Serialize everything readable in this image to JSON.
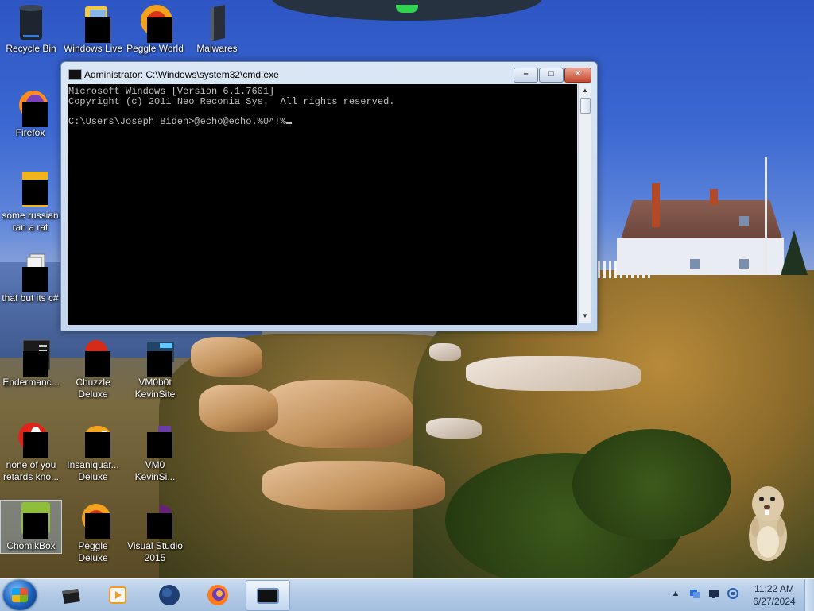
{
  "desktop": {
    "icons": [
      {
        "label": "Recycle Bin",
        "icon": "recycle-bin-icon"
      },
      {
        "label": "Windows Live",
        "icon": "windows-live-icon"
      },
      {
        "label": "Peggle World",
        "icon": "peggle-icon"
      },
      {
        "label": "Malwares",
        "icon": "folder-icon"
      },
      {
        "label": "Firefox",
        "icon": "firefox-icon"
      },
      {
        "label": "some russian ran a rat",
        "icon": "script-icon"
      },
      {
        "label": "that but its c#",
        "icon": "copies-icon"
      },
      {
        "label": "Endermanc...",
        "icon": "app-icon"
      },
      {
        "label": "Chuzzle Deluxe",
        "icon": "chuzzle-icon"
      },
      {
        "label": "VM0b0t KevinSite",
        "icon": "vm-icon"
      },
      {
        "label": "none of you retards kno...",
        "icon": "opera-icon"
      },
      {
        "label": "Insaniquar... Deluxe",
        "icon": "insaniquarium-icon"
      },
      {
        "label": "VM0 KevinSi...",
        "icon": "vm-icon"
      },
      {
        "label": "ChomikBox",
        "icon": "chomikbox-icon"
      },
      {
        "label": "Peggle Deluxe",
        "icon": "peggle-icon"
      },
      {
        "label": "Visual Studio 2015",
        "icon": "visual-studio-icon"
      }
    ]
  },
  "cmd_window": {
    "title": "Administrator: C:\\Windows\\system32\\cmd.exe",
    "buttons": {
      "minimize": "–",
      "maximize": "□",
      "close": "✕"
    },
    "lines": [
      "Microsoft Windows [Version 6.1.7601]",
      "Copyright (c) 2011 Neo Reconia Sys.  All rights reserved.",
      "",
      "C:\\Users\\Joseph Biden>@echo@echo.%0^!%"
    ]
  },
  "taskbar": {
    "pinned": [
      "explorer-icon",
      "media-player-icon",
      "globe-icon",
      "firefox-icon",
      "cmd-icon"
    ],
    "tray_icons": [
      "show-hidden-icon",
      "network-icon",
      "display-icon",
      "volume-icon"
    ],
    "tray_chevron": "▲",
    "clock": {
      "time": "11:22 AM",
      "date": "6/27/2024"
    }
  },
  "colors": {
    "console_bg": "#000000",
    "console_fg": "#c0c0c0",
    "taskbar": "#b4cbe6"
  }
}
